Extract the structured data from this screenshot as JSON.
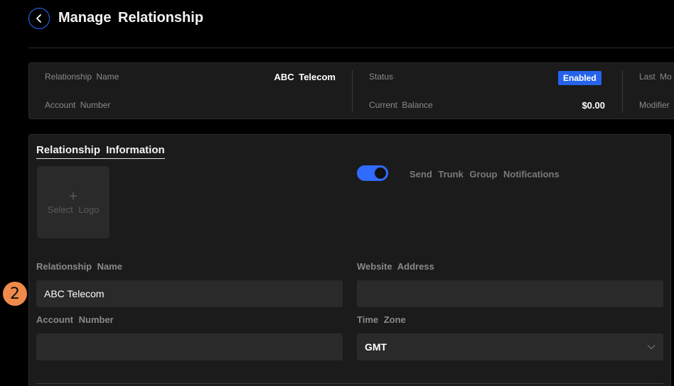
{
  "header": {
    "title": "Manage Relationship"
  },
  "summary": {
    "relationship_name_label": "Relationship Name",
    "relationship_name_value": "ABC Telecom",
    "account_number_label": "Account Number",
    "status_label": "Status",
    "status_value": "Enabled",
    "current_balance_label": "Current Balance",
    "current_balance_value": "$0.00",
    "last_modified_label": "Last Mo",
    "modified_by_label": "Modifier"
  },
  "info": {
    "section_title": "Relationship Information",
    "logo_plus": "+",
    "logo_label": "Select Logo",
    "notifications_label": "Send Trunk Group Notifications",
    "notifications_enabled": true,
    "relationship_name_label": "Relationship Name",
    "relationship_name_value": "ABC Telecom",
    "website_label": "Website Address",
    "website_value": "",
    "account_number_label": "Account Number",
    "account_number_value": "",
    "timezone_label": "Time Zone",
    "timezone_value": "GMT"
  },
  "step_marker": "2",
  "colors": {
    "accent": "#2f6bff",
    "status_badge": "#2563eb",
    "step_marker": "#f08a4b",
    "background": "#000000",
    "panel": "#1b1b1b",
    "input": "#2a2a2a"
  },
  "icons": {
    "back": "chevron-left-icon",
    "dropdown": "chevron-down-icon"
  }
}
